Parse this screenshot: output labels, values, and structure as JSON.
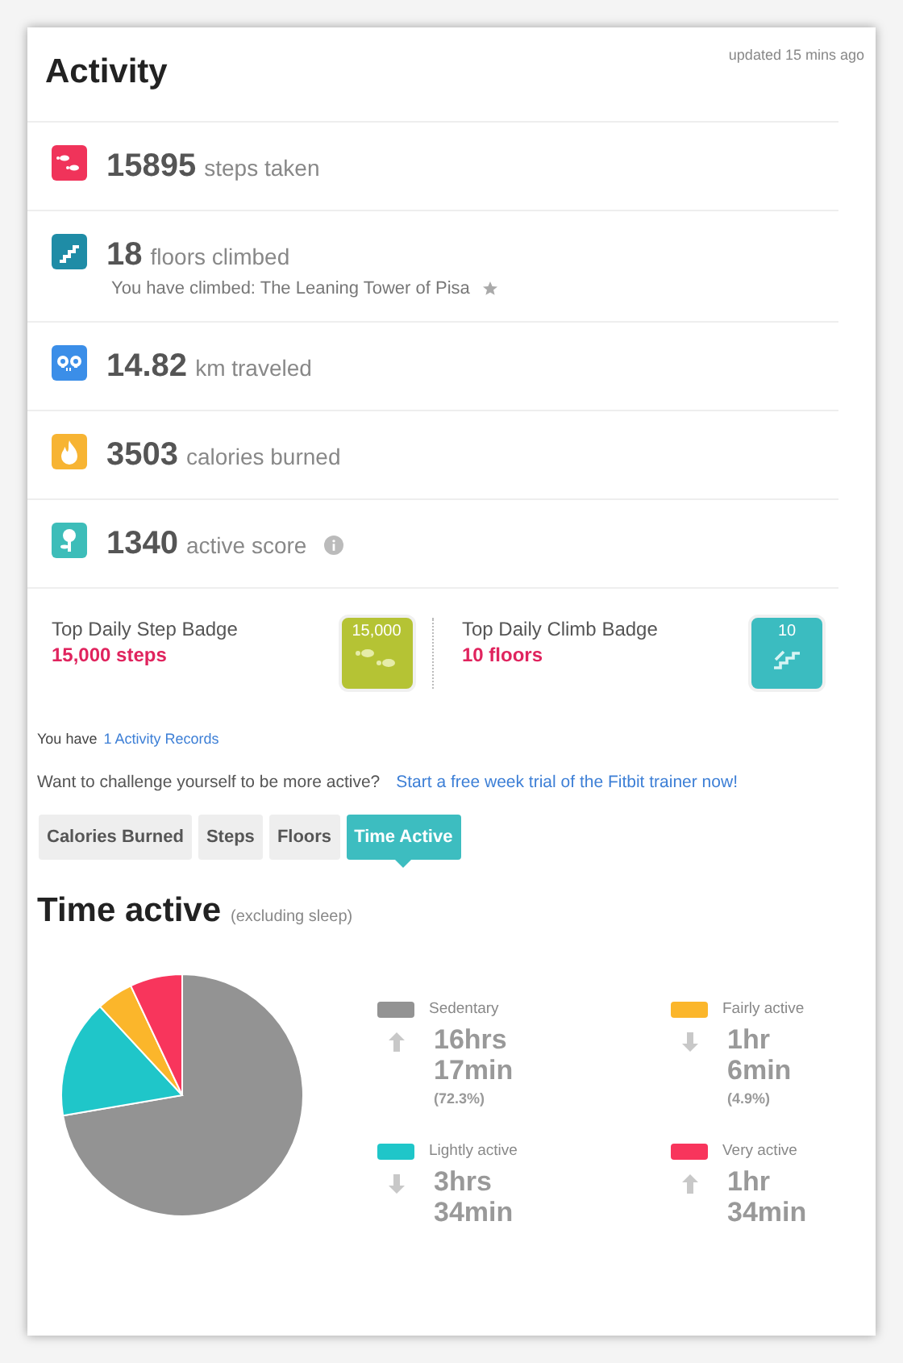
{
  "header": {
    "title": "Activity",
    "updated": "updated 15 mins ago"
  },
  "stats": [
    {
      "kind": "steps",
      "color": "#f0335a",
      "value": "15895",
      "label": "steps taken"
    },
    {
      "kind": "floors",
      "color": "#1f8ca6",
      "value": "18",
      "label": "floors climbed",
      "note": "You have climbed: The Leaning Tower of Pisa"
    },
    {
      "kind": "distance",
      "color": "#3b8ee8",
      "value": "14.82",
      "label": "km traveled"
    },
    {
      "kind": "calories",
      "color": "#f7b433",
      "value": "3503",
      "label": "calories burned"
    },
    {
      "kind": "score",
      "color": "#3dbdb9",
      "value": "1340",
      "label": "active score",
      "info": true
    }
  ],
  "badges": [
    {
      "kind": "steps",
      "title": "Top Daily Step Badge",
      "value": "15,000 steps",
      "badge_text": "15,000",
      "color": "#b5c334"
    },
    {
      "kind": "floors",
      "title": "Top Daily Climb Badge",
      "value": "10 floors",
      "badge_text": "10",
      "color": "#3bbcc0"
    }
  ],
  "records": {
    "text": "You have",
    "link": "1 Activity Records"
  },
  "challenge": {
    "text": "Want to challenge yourself to be more active?",
    "link": "Start a free week trial of the Fitbit trainer now!"
  },
  "tabs": [
    {
      "label": "Calories Burned",
      "selected": false
    },
    {
      "label": "Steps",
      "selected": false
    },
    {
      "label": "Floors",
      "selected": false
    },
    {
      "label": "Time Active",
      "selected": true
    }
  ],
  "time_active": {
    "title": "Time active",
    "subtitle": "(excluding sleep)",
    "chart_data": {
      "type": "pie",
      "categories": [
        "Sedentary",
        "Lightly active",
        "Fairly active",
        "Very active"
      ],
      "values": [
        72.3,
        15.8,
        4.9,
        7
      ],
      "colors": [
        "#939393",
        "#1fc6c9",
        "#fbb62b",
        "#f8355c"
      ]
    },
    "legend": [
      {
        "rising": true,
        "time": "16hrs 17min",
        "percent": "(72.3%)"
      },
      {
        "rising": false,
        "time": "3hrs 34min"
      },
      {
        "rising": false,
        "time": "1hr 6min",
        "percent": "(4.9%)"
      },
      {
        "rising": true,
        "time": "1hr 34min"
      }
    ]
  }
}
